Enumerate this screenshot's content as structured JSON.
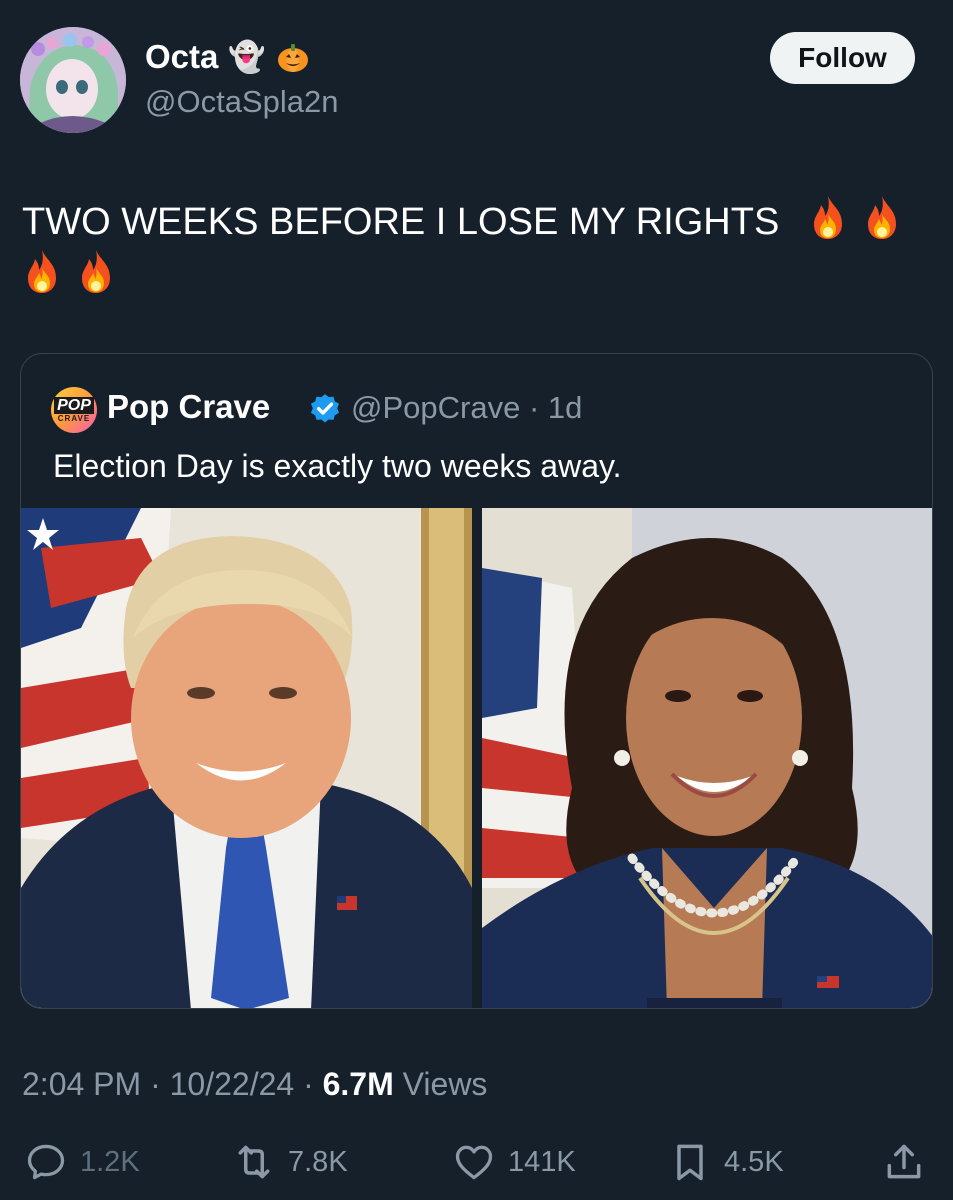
{
  "author": {
    "display_name": "Octa",
    "name_emojis": "👻",
    "handle": "@OctaSpla2n",
    "follow_label": "Follow"
  },
  "tweet": {
    "text": "TWO WEEKS BEFORE I LOSE MY RIGHTS"
  },
  "quoted": {
    "display_name": "Pop Crave",
    "avatar_top": "POP",
    "avatar_bottom": "CRAVE",
    "handle": "@PopCrave",
    "separator": "·",
    "age": "1d",
    "text": "Election Day is exactly two weeks away."
  },
  "meta": {
    "time": "2:04 PM",
    "date": "10/22/24",
    "views_count": "6.7M",
    "views_label": "Views",
    "dot": "·"
  },
  "actions": {
    "replies": "1.2K",
    "reposts": "7.8K",
    "likes": "141K",
    "bookmarks": "4.5K"
  },
  "colors": {
    "background": "#15202b",
    "muted": "#8b98a5",
    "border": "#38444d",
    "verified": "#1d9bf0"
  }
}
